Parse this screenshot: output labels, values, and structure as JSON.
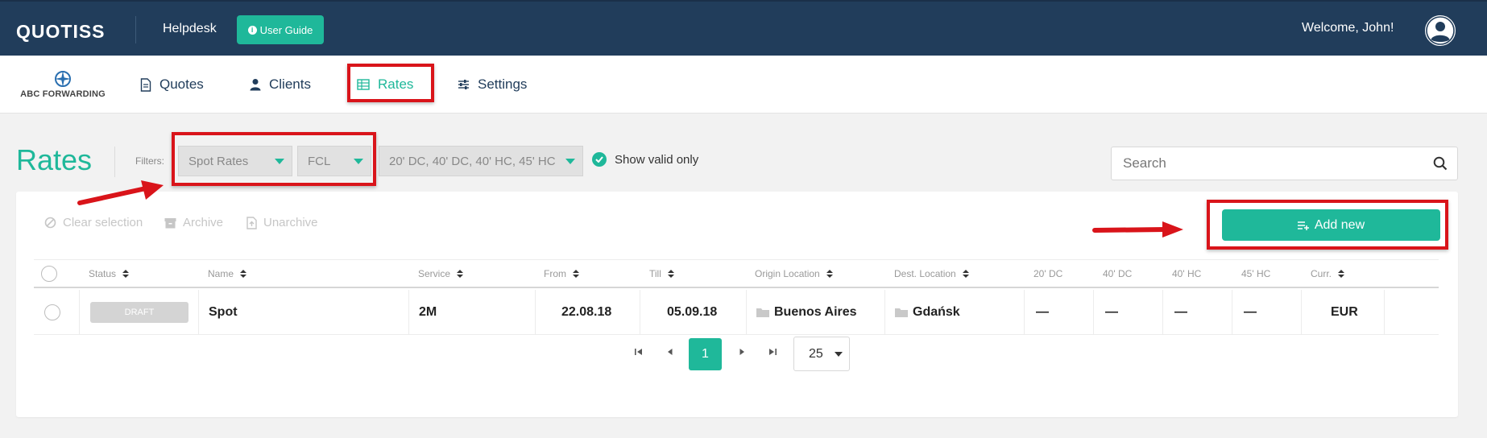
{
  "topbar": {
    "logo": "QUOTISS",
    "helpdesk": "Helpdesk",
    "user_guide": "User Guide",
    "welcome": "Welcome, John!"
  },
  "navbar": {
    "brand": "ABC FORWARDING",
    "items": [
      {
        "label": "Quotes",
        "icon": "document-icon"
      },
      {
        "label": "Clients",
        "icon": "user-icon"
      },
      {
        "label": "Rates",
        "icon": "table-icon",
        "active": true
      },
      {
        "label": "Settings",
        "icon": "sliders-icon"
      }
    ]
  },
  "page": {
    "title": "Rates",
    "filters_label": "Filters:",
    "filters": {
      "rate_type": "Spot Rates",
      "mode": "FCL",
      "containers": "20' DC, 40' DC, 40' HC, 45' HC"
    },
    "show_valid_only": "Show valid only",
    "search_placeholder": "Search"
  },
  "toolbar": {
    "clear_selection": "Clear selection",
    "archive": "Archive",
    "unarchive": "Unarchive",
    "add_new": "Add new"
  },
  "table": {
    "columns": [
      "Status",
      "Name",
      "Service",
      "From",
      "Till",
      "Origin Location",
      "Dest. Location",
      "20' DC",
      "40' DC",
      "40' HC",
      "45' HC",
      "Curr."
    ],
    "rows": [
      {
        "status": "DRAFT",
        "name": "Spot",
        "service": "2M",
        "from": "22.08.18",
        "till": "05.09.18",
        "origin": "Buenos Aires",
        "dest": "Gdańsk",
        "dc20": "—",
        "dc40": "—",
        "hc40": "—",
        "hc45": "—",
        "currency": "EUR"
      }
    ]
  },
  "pagination": {
    "current_page": "1",
    "page_size": "25"
  },
  "colors": {
    "accent": "#1fb89a",
    "topbar": "#213d5b",
    "annotation": "#d9141a"
  }
}
